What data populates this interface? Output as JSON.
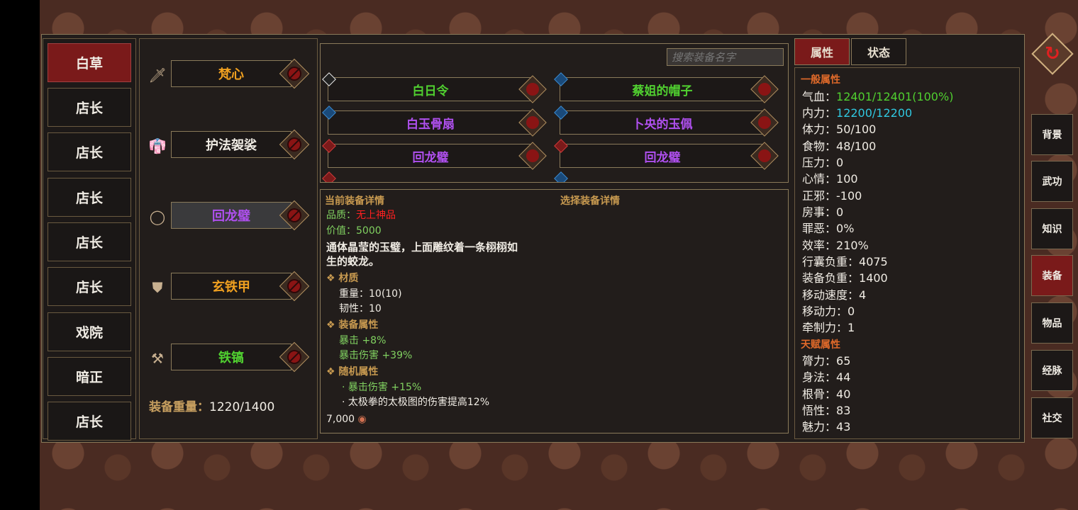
{
  "characters": [
    "白草",
    "店长",
    "店长",
    "店长",
    "店长",
    "店长",
    "戏院",
    "暗正",
    "店长"
  ],
  "equipment_slots": [
    {
      "icon": "sword-icon",
      "name": "梵心",
      "color": "#f0a020"
    },
    {
      "icon": "robe-icon",
      "name": "护法袈裟",
      "color": "#f0ece4"
    },
    {
      "icon": "ring-icon",
      "name": "回龙璧",
      "color": "#b050f0"
    },
    {
      "icon": "armor-icon",
      "name": "玄铁甲",
      "color": "#f0a020"
    },
    {
      "icon": "pickaxe-icon",
      "name": "铁镐",
      "color": "#50d030"
    }
  ],
  "equip_weight_label": "装备重量：",
  "equip_weight_value": "1220/1400",
  "search_placeholder": "搜索装备名字",
  "items": [
    {
      "name": "白日令",
      "color": "#50d030",
      "tag": "white"
    },
    {
      "name": "蔡姐的帽子",
      "color": "#50d030",
      "tag": "blue"
    },
    {
      "name": "白玉骨扇",
      "color": "#b050f0",
      "tag": "blue"
    },
    {
      "name": "卜央的玉佩",
      "color": "#b050f0",
      "tag": "blue"
    },
    {
      "name": "回龙璧",
      "color": "#b050f0",
      "tag": "red"
    },
    {
      "name": "回龙璧",
      "color": "#b050f0",
      "tag": "red"
    }
  ],
  "details": {
    "current_header": "当前装备详情",
    "select_header": "选择装备详情",
    "quality_label": "品质：",
    "quality_value": "无上神品",
    "value_label": "价值：",
    "value_value": "5000",
    "desc1": "通体晶莹的玉璧，上面雕纹着一条栩栩如",
    "desc2": "生的蛟龙。",
    "material_header": "❖ 材质",
    "weight": "重量：10(10)",
    "toughness": "韧性：10",
    "equip_attr_header": "❖ 装备属性",
    "crit": "暴击 +8%",
    "crit_dmg": "暴击伤害 +39%",
    "random_header": "❖ 随机属性",
    "rand1": "· 暴击伤害 +15%",
    "rand2": "· 太极拳的太极图的伤害提高12%",
    "price": "7,000"
  },
  "tabs": [
    "属性",
    "状态"
  ],
  "general_header": "一般属性",
  "attributes": [
    {
      "label": "气血：",
      "value": "12401/12401(100%)",
      "color": "#50d030"
    },
    {
      "label": "内力：",
      "value": "12200/12200",
      "color": "#30c8e0"
    },
    {
      "label": "体力：",
      "value": "50/100",
      "color": "#f0ece4"
    },
    {
      "label": "食物：",
      "value": "48/100",
      "color": "#f0ece4"
    },
    {
      "label": "压力：",
      "value": "0",
      "color": "#f0ece4"
    },
    {
      "label": "心情：",
      "value": "100",
      "color": "#f0ece4"
    },
    {
      "label": "正邪：",
      "value": "-100",
      "color": "#f0ece4"
    },
    {
      "label": "房事：",
      "value": "0",
      "color": "#f0ece4"
    },
    {
      "label": "罪恶：",
      "value": "0%",
      "color": "#f0ece4"
    },
    {
      "label": "效率：",
      "value": "210%",
      "color": "#f0ece4"
    },
    {
      "label": "行囊负重：",
      "value": "4075",
      "color": "#f0ece4"
    },
    {
      "label": "装备负重：",
      "value": "1400",
      "color": "#f0ece4"
    },
    {
      "label": "移动速度：",
      "value": "4",
      "color": "#f0ece4"
    },
    {
      "label": "移动力：",
      "value": "0",
      "color": "#f0ece4"
    },
    {
      "label": "牵制力：",
      "value": "1",
      "color": "#f0ece4"
    }
  ],
  "talent_header": "天赋属性",
  "talents": [
    {
      "label": "膂力：",
      "value": "65"
    },
    {
      "label": "身法：",
      "value": "44"
    },
    {
      "label": "根骨：",
      "value": "40"
    },
    {
      "label": "悟性：",
      "value": "83"
    },
    {
      "label": "魅力：",
      "value": "43"
    }
  ],
  "nav": [
    "背景",
    "武功",
    "知识",
    "装备",
    "物品",
    "经脉",
    "社交"
  ],
  "active_nav": "装备"
}
